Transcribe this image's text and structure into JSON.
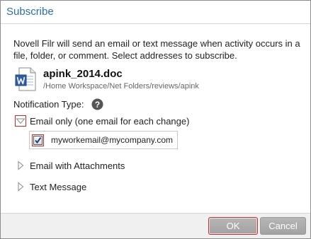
{
  "dialog": {
    "title": "Subscribe"
  },
  "description": "Novell Filr will send an email or text message when activity occurs in a file, folder, or comment. Select addresses to subscribe.",
  "file": {
    "name": "apink_2014.doc",
    "path": "/Home Workspace/Net Folders/reviews/apink",
    "icon": "word-document-icon"
  },
  "notification": {
    "label": "Notification Type:",
    "help_icon": "question-mark-icon",
    "options": [
      {
        "label": "Email only (one email for each change)",
        "expanded": true,
        "addresses": [
          {
            "email": "myworkemail@mycompany.com",
            "checked": true
          }
        ]
      },
      {
        "label": "Email with Attachments",
        "expanded": false
      },
      {
        "label": "Text Message",
        "expanded": false
      }
    ]
  },
  "footer": {
    "ok_label": "OK",
    "cancel_label": "Cancel"
  },
  "colors": {
    "title": "#2a6fa8",
    "focus_outline": "#c9272c",
    "button_bg": "#a8a8a8",
    "footer_bg": "#f0f0f0"
  }
}
